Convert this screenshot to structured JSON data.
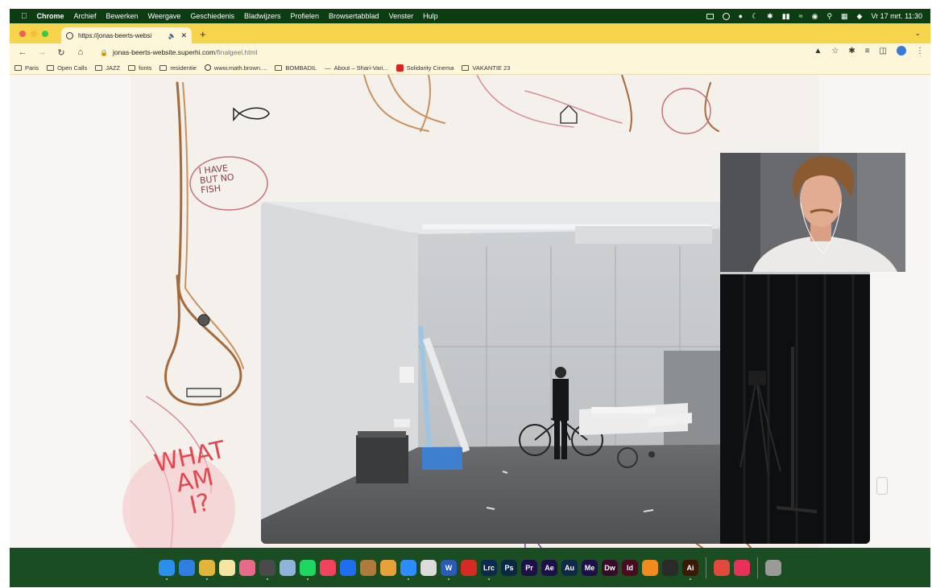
{
  "menubar": {
    "app_name": "Chrome",
    "items": [
      "Archief",
      "Bewerken",
      "Weergave",
      "Geschiedenis",
      "Bladwijzers",
      "Profielen",
      "Browsertabblad",
      "Venster",
      "Hulp"
    ],
    "clock": "Vr 17 mrt. 11:30"
  },
  "tab": {
    "title": "https://jonas-beerts-websi",
    "new_tab_label": "+"
  },
  "toolbar": {
    "url_domain": "jonas-beerts-website.superhi.com",
    "url_path": "/finalgeel.html"
  },
  "bookmarks": [
    {
      "label": "Paris",
      "icon": "folder-icon"
    },
    {
      "label": "Open Calls",
      "icon": "folder-icon"
    },
    {
      "label": "JAZZ",
      "icon": "folder-icon"
    },
    {
      "label": "fonts",
      "icon": "folder-icon"
    },
    {
      "label": "residentie",
      "icon": "folder-icon"
    },
    {
      "label": "www.math.brown....",
      "icon": "globe-icon"
    },
    {
      "label": "BOMBADIL",
      "icon": "folder-icon"
    },
    {
      "label": "About – Shari-Vari...",
      "icon": "dash-icon"
    },
    {
      "label": "Solidarity Cinema",
      "icon": "pdf-icon"
    },
    {
      "label": "VAKANTIE 23",
      "icon": "folder-icon"
    }
  ],
  "page": {
    "speech_bubble_line1": "I HAVE",
    "speech_bubble_line2": "BUT NO",
    "speech_bubble_line3": "FISH",
    "what_line1": "WHAT",
    "what_line2": "AM",
    "what_line3": "I?"
  },
  "dock": [
    {
      "name": "finder",
      "label": "",
      "color": "#2b8ee8"
    },
    {
      "name": "safari",
      "label": "",
      "color": "#2f7fe0"
    },
    {
      "name": "chrome",
      "label": "",
      "color": "#e2b53a"
    },
    {
      "name": "notes",
      "label": "",
      "color": "#f4e6a0"
    },
    {
      "name": "photos",
      "label": "",
      "color": "#e86a8a"
    },
    {
      "name": "quicktime",
      "label": "",
      "color": "#4a4a4a"
    },
    {
      "name": "preview",
      "label": "",
      "color": "#8fb3d9"
    },
    {
      "name": "spotify",
      "label": "",
      "color": "#1ed760"
    },
    {
      "name": "music",
      "label": "",
      "color": "#f2425e"
    },
    {
      "name": "shazam",
      "label": "",
      "color": "#1f6ef0"
    },
    {
      "name": "garageband",
      "label": "",
      "color": "#b07a3a"
    },
    {
      "name": "logic",
      "label": "",
      "color": "#e8a13a"
    },
    {
      "name": "zoom",
      "label": "",
      "color": "#2d8cff"
    },
    {
      "name": "blank-app",
      "label": "",
      "color": "#dcdcdc"
    },
    {
      "name": "word",
      "label": "W",
      "color": "#2b5bb8"
    },
    {
      "name": "acrobat",
      "label": "",
      "color": "#d62a22"
    },
    {
      "name": "lightroom",
      "label": "Lrc",
      "color": "#0c2a4d"
    },
    {
      "name": "photoshop",
      "label": "Ps",
      "color": "#0a2744"
    },
    {
      "name": "premiere",
      "label": "Pr",
      "color": "#1d0f4a"
    },
    {
      "name": "after-effects",
      "label": "Ae",
      "color": "#1d0f4a"
    },
    {
      "name": "audition",
      "label": "Au",
      "color": "#10294a"
    },
    {
      "name": "media-encoder",
      "label": "Me",
      "color": "#1d0f4a"
    },
    {
      "name": "dreamweaver",
      "label": "Dw",
      "color": "#3a0a2a"
    },
    {
      "name": "indesign",
      "label": "Id",
      "color": "#4a0a20"
    },
    {
      "name": "blender",
      "label": "",
      "color": "#f28a1d"
    },
    {
      "name": "openai",
      "label": "",
      "color": "#2a2a2a"
    },
    {
      "name": "illustrator",
      "label": "Ai",
      "color": "#3a1a05"
    },
    {
      "name": "fantastical",
      "label": "",
      "color": "#e04a3a"
    },
    {
      "name": "creative-cloud",
      "label": "",
      "color": "#e8305a"
    },
    {
      "name": "trash",
      "label": "",
      "color": "#9a9a9a"
    }
  ]
}
